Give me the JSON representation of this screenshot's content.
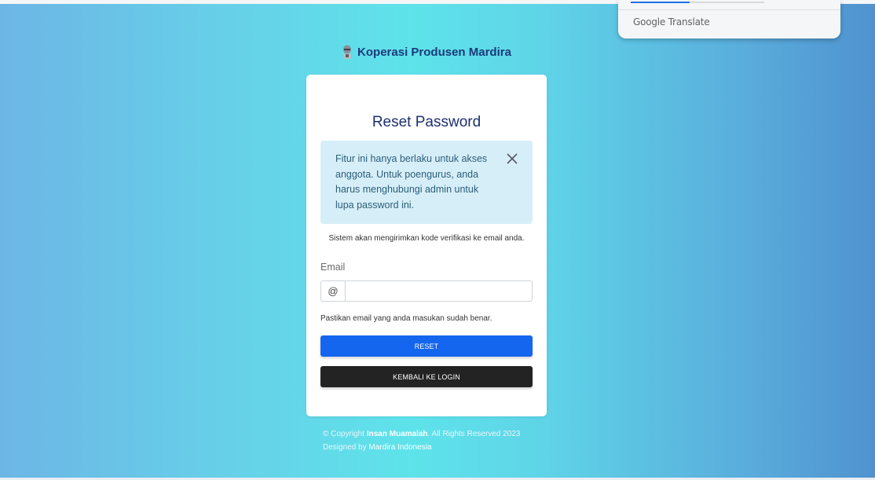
{
  "google_translate": {
    "brand_google": "Google",
    "brand_translate": "Translate"
  },
  "brand": {
    "name": "Koperasi Produsen Mardira"
  },
  "card": {
    "title": "Reset Password",
    "alert_text": "Fitur ini hanya berlaku untuk akses anggota. Untuk poengurus, anda harus menghubungi admin untuk lupa password ini.",
    "info_text": "Sistem akan mengirimkan kode verifikasi ke email anda.",
    "email_label": "Email",
    "email_prefix": "@",
    "email_value": "",
    "hint_text": "Pastikan email yang anda masukan sudah benar.",
    "reset_label": "RESET",
    "login_label": "KEMBALI KE LOGIN"
  },
  "footer": {
    "copyright_prefix": "© Copyright",
    "copyright_owner": "Insan Muamalah",
    "copyright_suffix": ". All Rights Reserved 2023",
    "designed_prefix": "Designed by",
    "designer": "Mardira Indonesia"
  },
  "colors": {
    "primary": "#1466ee",
    "dark": "#232323",
    "alert_bg": "#d6eef8",
    "title": "#1d2f6e"
  }
}
